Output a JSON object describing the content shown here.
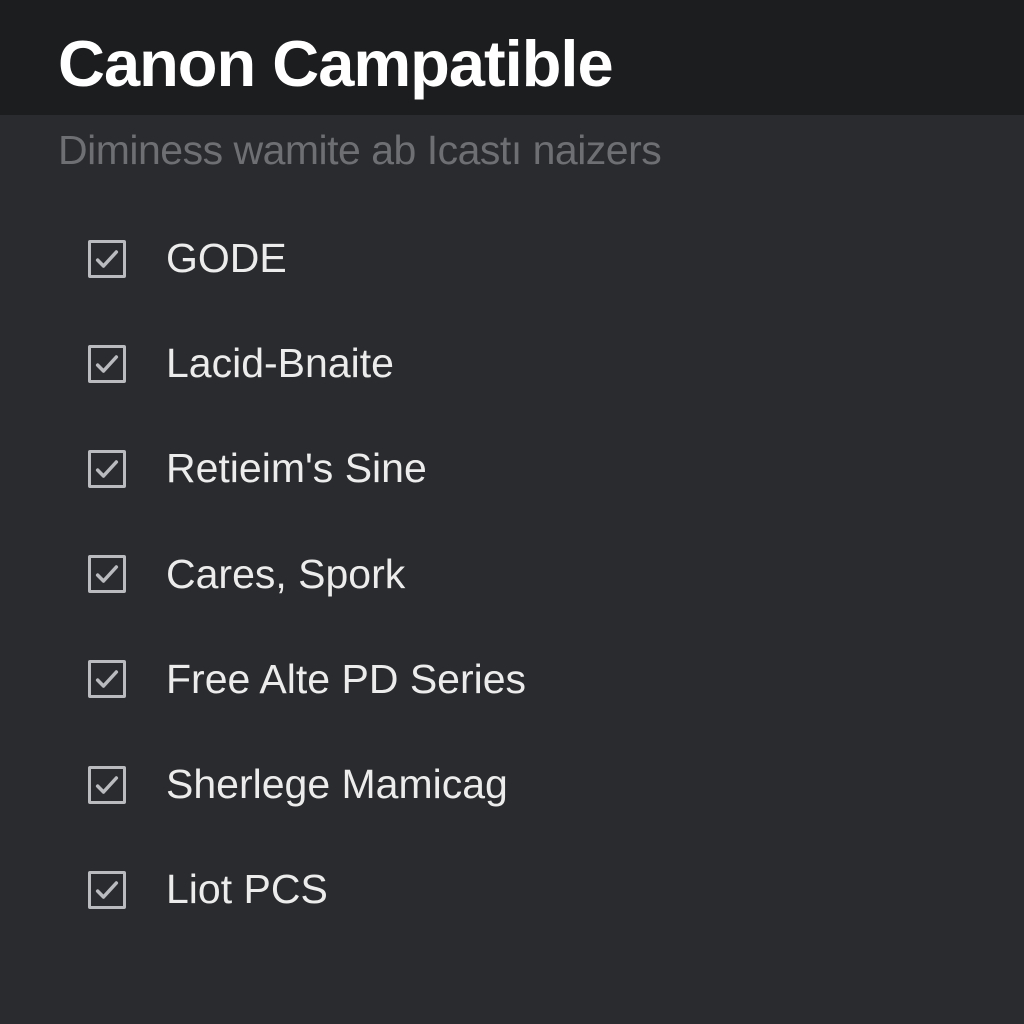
{
  "header": {
    "title": "Canon Campatible",
    "subtitle": "Diminess wamite ab Icastı naizers"
  },
  "list": {
    "items": [
      {
        "label": "GODE",
        "checked": true
      },
      {
        "label": "Lacid-Bnaite",
        "checked": true
      },
      {
        "label": "Retieim's Sine",
        "checked": true
      },
      {
        "label": "Cares, Spork",
        "checked": true
      },
      {
        "label": "Free Alte PD Series",
        "checked": true
      },
      {
        "label": "Sherlege Mamicag",
        "checked": true
      },
      {
        "label": "Liot PCS",
        "checked": true
      }
    ]
  }
}
